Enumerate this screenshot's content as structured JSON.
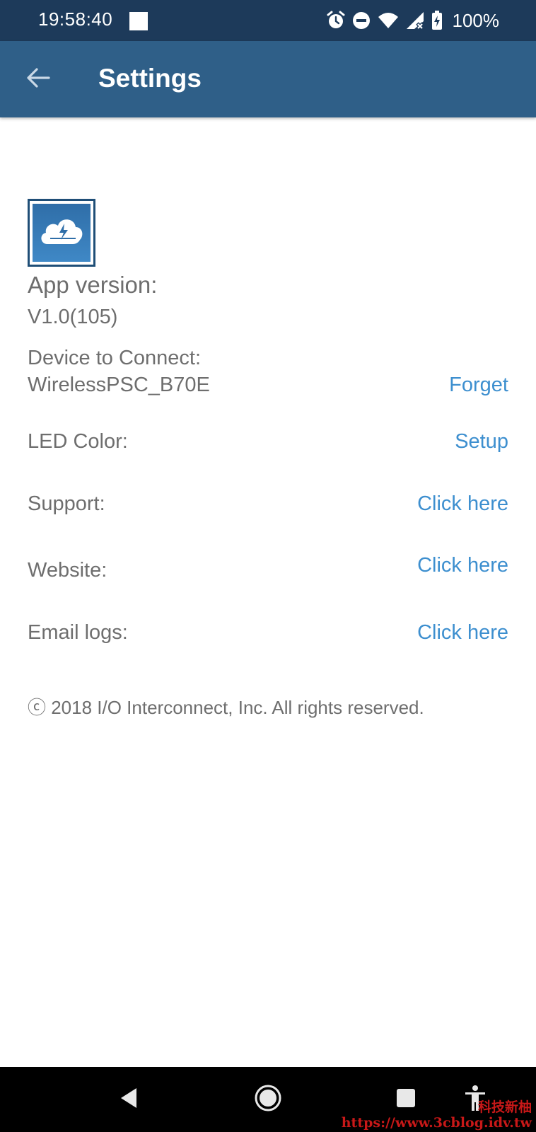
{
  "status_bar": {
    "time": "19:58:40",
    "battery": "100%",
    "icons": [
      "notification-square-icon",
      "alarm-icon",
      "do-not-disturb-icon",
      "wifi-icon",
      "cell-signal-off-icon",
      "battery-charging-icon"
    ]
  },
  "toolbar": {
    "title": "Settings",
    "back_icon": "arrow-back-icon"
  },
  "app": {
    "icon": "cloud-lightning-icon",
    "version_label": "App version:",
    "version_value": "V1.0(105)"
  },
  "device": {
    "label": "Device to Connect:",
    "name": "WirelessPSC_B70E",
    "action": "Forget"
  },
  "rows": [
    {
      "label": "LED Color:",
      "action": "Setup"
    },
    {
      "label": "Support:",
      "action": "Click here"
    },
    {
      "label": "Website:",
      "action": "Click here"
    },
    {
      "label": "Email logs:",
      "action": "Click here"
    }
  ],
  "copyright": "ⓒ 2018 I/O Interconnect, Inc. All rights reserved.",
  "nav_bar": {
    "icons": [
      "nav-back-icon",
      "nav-home-icon",
      "nav-recents-icon",
      "accessibility-icon"
    ]
  },
  "watermark": {
    "line1": "科技新柚",
    "line2": "https://www.3cblog.idv.tw"
  },
  "colors": {
    "status_bar": "#1d3a5a",
    "toolbar": "#2f5f88",
    "link": "#3d8fcf",
    "text": "#6e6e6e"
  }
}
